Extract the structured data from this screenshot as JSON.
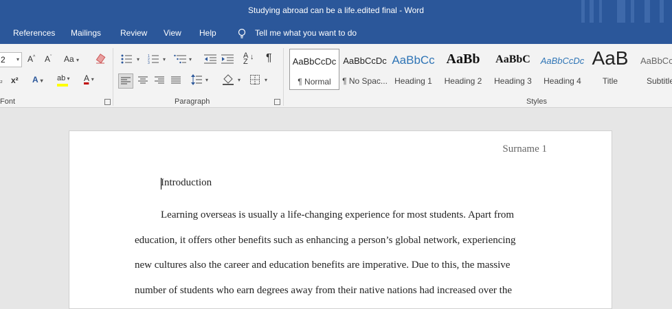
{
  "title_bar": {
    "title": "Studying abroad can be a life.edited final  -  Word"
  },
  "tabs": [
    "References",
    "Mailings",
    "Review",
    "View",
    "Help"
  ],
  "tell_me": "Tell me what you want to do",
  "ribbon": {
    "font_size": "2",
    "font_group_label": "Font",
    "paragraph_group_label": "Paragraph",
    "styles_group_label": "Styles",
    "styles": [
      {
        "preview": "AaBbCcDc",
        "name": "¶ Normal"
      },
      {
        "preview": "AaBbCcDc",
        "name": "¶ No Spac..."
      },
      {
        "preview": "AaBbCc",
        "name": "Heading 1"
      },
      {
        "preview": "AaBb",
        "name": "Heading 2"
      },
      {
        "preview": "AaBbC",
        "name": "Heading 3"
      },
      {
        "preview": "AaBbCcDc",
        "name": "Heading 4"
      },
      {
        "preview": "AaB",
        "name": "Title"
      },
      {
        "preview": "AaBbCc",
        "name": "Subtitle"
      }
    ],
    "colors": {
      "highlight": "#ffff00",
      "font_color": "#c00000"
    }
  },
  "document": {
    "header_text": "Surname 1",
    "heading": "Introduction",
    "lines": [
      "Learning overseas is usually a life-changing experience for most students. Apart from",
      "education, it offers other benefits such as enhancing a person’s global network, experiencing",
      "new cultures also the career and education benefits are imperative. Due to this, the massive",
      "number of students who earn degrees away from their native nations had increased over the"
    ]
  },
  "theme": {
    "accent": "#2b579a"
  }
}
